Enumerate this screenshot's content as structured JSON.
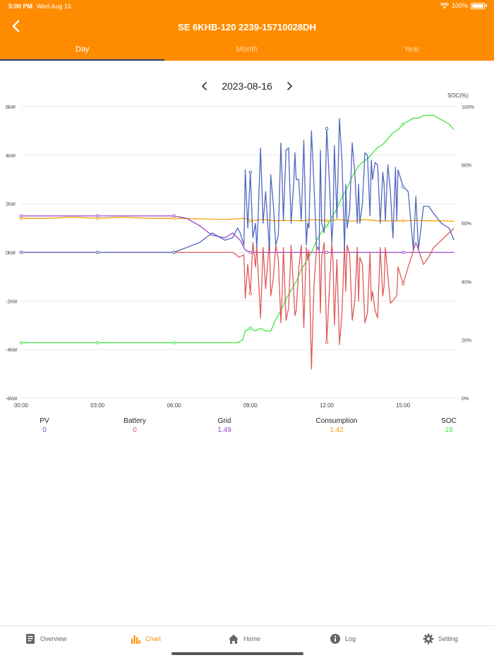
{
  "status_bar": {
    "time": "5:00 PM",
    "date": "Wed Aug 16",
    "battery": "100%"
  },
  "header": {
    "title": "SE 6KHB-120 2239-15710028DH"
  },
  "tabs": [
    {
      "label": "Day"
    },
    {
      "label": "Month"
    },
    {
      "label": "Year"
    }
  ],
  "date_nav": {
    "date": "2023-08-16"
  },
  "summary": [
    {
      "label": "PV",
      "value": "0",
      "color": "#5068c0"
    },
    {
      "label": "Battery",
      "value": "0",
      "color": "#e05a5a"
    },
    {
      "label": "Grid",
      "value": "1.49",
      "color": "#9a46c8"
    },
    {
      "label": "Consumption",
      "value": "1.42",
      "color": "#f5a000"
    },
    {
      "label": "SOC",
      "value": "19",
      "color": "#3ee83e"
    }
  ],
  "bottom_nav": [
    {
      "label": "Overview",
      "icon": "document-icon"
    },
    {
      "label": "Chart",
      "icon": "bar-chart-icon"
    },
    {
      "label": "Home",
      "icon": "home-icon"
    },
    {
      "label": "Log",
      "icon": "info-icon"
    },
    {
      "label": "Setting",
      "icon": "gear-icon"
    }
  ],
  "chart_data": {
    "type": "line",
    "title": "",
    "left_axis_label": "",
    "right_axis_label": "SOC(%)",
    "ylim": [
      -6,
      6
    ],
    "y2lim": [
      0,
      100
    ],
    "xlim": [
      0,
      17.1
    ],
    "x_ticks": [
      "00:00",
      "03:00",
      "06:00",
      "09:00",
      "12:00",
      "15:00"
    ],
    "x_tick_values": [
      0,
      3,
      6,
      9,
      12,
      15
    ],
    "y_ticks": [
      "6kW",
      "4kW",
      "2kW",
      "0kW",
      "-2kW",
      "-4kW",
      "-6kW"
    ],
    "y_tick_values": [
      6,
      4,
      2,
      0,
      -2,
      -4,
      -6
    ],
    "y2_ticks": [
      "100%",
      "80%",
      "60%",
      "40%",
      "20%",
      "0%"
    ],
    "y2_tick_values": [
      100,
      80,
      60,
      40,
      20,
      0
    ],
    "grid": true,
    "series": [
      {
        "name": "PV",
        "color": "#5068c0",
        "axis": "left",
        "x": [
          0,
          3,
          6,
          6.5,
          7,
          7.5,
          8,
          8.3,
          8.5,
          8.6,
          8.75,
          8.8,
          8.9,
          9.0,
          9.1,
          9.2,
          9.25,
          9.3,
          9.4,
          9.5,
          9.6,
          9.75,
          9.8,
          9.9,
          10.0,
          10.1,
          10.2,
          10.25,
          10.3,
          10.4,
          10.5,
          10.6,
          10.7,
          10.75,
          10.8,
          10.9,
          11.0,
          11.1,
          11.2,
          11.25,
          11.3,
          11.4,
          11.5,
          11.6,
          11.7,
          11.75,
          11.8,
          11.9,
          12.0,
          12.1,
          12.2,
          12.25,
          12.3,
          12.4,
          12.5,
          12.6,
          12.7,
          12.75,
          12.8,
          12.9,
          13.0,
          13.1,
          13.2,
          13.25,
          13.3,
          13.4,
          13.5,
          13.6,
          13.7,
          13.75,
          13.8,
          13.9,
          14.0,
          14.1,
          14.2,
          14.25,
          14.3,
          14.4,
          14.5,
          14.6,
          14.7,
          14.75,
          14.8,
          15.0,
          15.2,
          15.4,
          15.5,
          15.6,
          15.8,
          16.0,
          16.2,
          16.5,
          16.8,
          17.0
        ],
        "y": [
          0,
          0,
          0,
          0.2,
          0.4,
          0.8,
          0.5,
          0.6,
          1.0,
          0.8,
          0.3,
          3.4,
          1.0,
          3.3,
          0.6,
          1.2,
          0.2,
          1.3,
          4.3,
          1.2,
          2.5,
          0.1,
          3.2,
          2.0,
          0.3,
          0.7,
          4.5,
          3.0,
          1.3,
          4.2,
          4.3,
          1.2,
          2.8,
          4.1,
          3.0,
          3.0,
          1.3,
          4.6,
          0.3,
          1.2,
          1.0,
          5.0,
          2.8,
          0.2,
          0.1,
          4.2,
          1.2,
          0.8,
          5.1,
          3.0,
          0.4,
          1.3,
          4.4,
          1.4,
          5.5,
          3.8,
          0.1,
          2.8,
          1.0,
          1.7,
          4.5,
          3.3,
          1.2,
          2.8,
          1.2,
          2.0,
          4.1,
          4.0,
          1.5,
          3.8,
          3.0,
          3.7,
          3.6,
          1.2,
          3.3,
          2.8,
          1.3,
          3.6,
          2.5,
          0.6,
          3.5,
          1.3,
          3.4,
          2.7,
          2.5,
          0.1,
          2.3,
          0.1,
          1.9,
          1.9,
          1.6,
          1.2,
          1.0,
          0.5
        ]
      },
      {
        "name": "Battery",
        "color": "#e05a5a",
        "axis": "left",
        "x": [
          0,
          3,
          6,
          8.3,
          8.45,
          8.55,
          8.75,
          8.8,
          8.9,
          9.0,
          9.1,
          9.2,
          9.25,
          9.3,
          9.4,
          9.5,
          9.6,
          9.75,
          9.8,
          9.9,
          10.0,
          10.1,
          10.2,
          10.25,
          10.3,
          10.4,
          10.5,
          10.6,
          10.7,
          10.75,
          10.8,
          10.9,
          11.0,
          11.1,
          11.2,
          11.25,
          11.3,
          11.4,
          11.5,
          11.6,
          11.7,
          11.75,
          11.8,
          11.9,
          12.0,
          12.1,
          12.2,
          12.25,
          12.3,
          12.4,
          12.5,
          12.6,
          12.7,
          12.75,
          12.8,
          12.9,
          13.0,
          13.1,
          13.2,
          13.25,
          13.3,
          13.4,
          13.5,
          13.6,
          13.7,
          13.75,
          13.8,
          13.9,
          14.0,
          14.1,
          14.2,
          14.25,
          14.3,
          14.5,
          14.75,
          14.8,
          15.0,
          15.2,
          15.5,
          15.8,
          16.0,
          16.2,
          16.5,
          16.8,
          17.0
        ],
        "y": [
          0,
          0,
          0,
          0,
          -0.1,
          -0.2,
          -0.1,
          -1.9,
          -0.5,
          -1.7,
          0.4,
          -0.6,
          0.3,
          -0.7,
          -2.7,
          0.2,
          -1.5,
          0.5,
          -1.8,
          -1.1,
          0.3,
          -0.3,
          -2.9,
          -1.7,
          0.2,
          -2.8,
          -2.3,
          0.3,
          -1.6,
          -2.6,
          -2.4,
          -0.7,
          0.3,
          -3.1,
          0.2,
          -0.3,
          0.1,
          -4.8,
          -1.4,
          0.2,
          0.2,
          -2.5,
          -0.2,
          0.4,
          -3.7,
          -1.6,
          0.4,
          -0.4,
          -3.0,
          -0.3,
          -3.8,
          -2.5,
          0.4,
          -1.6,
          0.3,
          -0.1,
          -2.8,
          -2.0,
          0.2,
          -2.0,
          -0.2,
          -0.5,
          -2.9,
          -2.5,
          0.0,
          -2.0,
          -1.6,
          -2.4,
          -2.7,
          0.2,
          -1.8,
          -1.4,
          0.2,
          -2.1,
          -1.8,
          -0.6,
          -1.3,
          -0.6,
          0.4,
          -0.5,
          -0.2,
          0.2,
          0.5,
          0.8,
          1.0
        ]
      },
      {
        "name": "Grid",
        "color": "#9a46c8",
        "axis": "left",
        "x": [
          0,
          1,
          2,
          3,
          4,
          5,
          6,
          6.5,
          7,
          7.5,
          8,
          8.3,
          8.6,
          8.8,
          9.0,
          10,
          11,
          12,
          13,
          14,
          15,
          16,
          17.0
        ],
        "y": [
          1.5,
          1.5,
          1.5,
          1.5,
          1.5,
          1.5,
          1.5,
          1.4,
          1.1,
          0.7,
          0.6,
          0.8,
          0.5,
          0.1,
          0.0,
          0.0,
          0.0,
          0.0,
          0.0,
          0.0,
          0.0,
          0.0,
          0.0
        ]
      },
      {
        "name": "Consumption",
        "color": "#f5a000",
        "axis": "left",
        "x": [
          0,
          1,
          2,
          3,
          4,
          5,
          6,
          7,
          8,
          8.8,
          9.0,
          9.5,
          10,
          10.5,
          11,
          11.5,
          12,
          12.5,
          13,
          13.5,
          14,
          14.5,
          15,
          15.5,
          16,
          16.5,
          17.0
        ],
        "y": [
          1.4,
          1.4,
          1.45,
          1.4,
          1.45,
          1.4,
          1.4,
          1.38,
          1.35,
          1.4,
          1.3,
          1.35,
          1.3,
          1.32,
          1.3,
          1.35,
          1.3,
          1.35,
          1.28,
          1.35,
          1.3,
          1.3,
          1.3,
          1.32,
          1.3,
          1.3,
          1.28
        ]
      },
      {
        "name": "SOC",
        "color": "#3ee83e",
        "axis": "right",
        "x": [
          0,
          3,
          6,
          8.5,
          8.7,
          8.8,
          9.0,
          9.2,
          9.4,
          9.6,
          9.8,
          10.0,
          10.2,
          10.4,
          10.6,
          10.8,
          11.0,
          11.2,
          11.4,
          11.6,
          11.8,
          12.0,
          12.2,
          12.4,
          12.6,
          12.8,
          13.0,
          13.2,
          13.4,
          13.6,
          13.8,
          14.0,
          14.2,
          14.4,
          14.6,
          14.8,
          15.0,
          15.2,
          15.4,
          15.6,
          15.8,
          16.0,
          16.2,
          16.4,
          16.6,
          16.8,
          17.0
        ],
        "y": [
          19,
          19,
          19,
          19,
          20,
          23,
          24,
          23,
          24,
          23,
          23,
          27,
          30,
          34,
          37,
          40,
          44,
          47,
          50,
          54,
          57,
          59,
          62,
          65,
          69,
          72,
          76,
          79,
          81,
          82,
          84,
          86,
          87,
          89,
          91,
          92,
          94,
          95,
          96,
          96,
          97,
          97,
          97,
          96,
          95,
          94,
          92
        ]
      }
    ]
  }
}
